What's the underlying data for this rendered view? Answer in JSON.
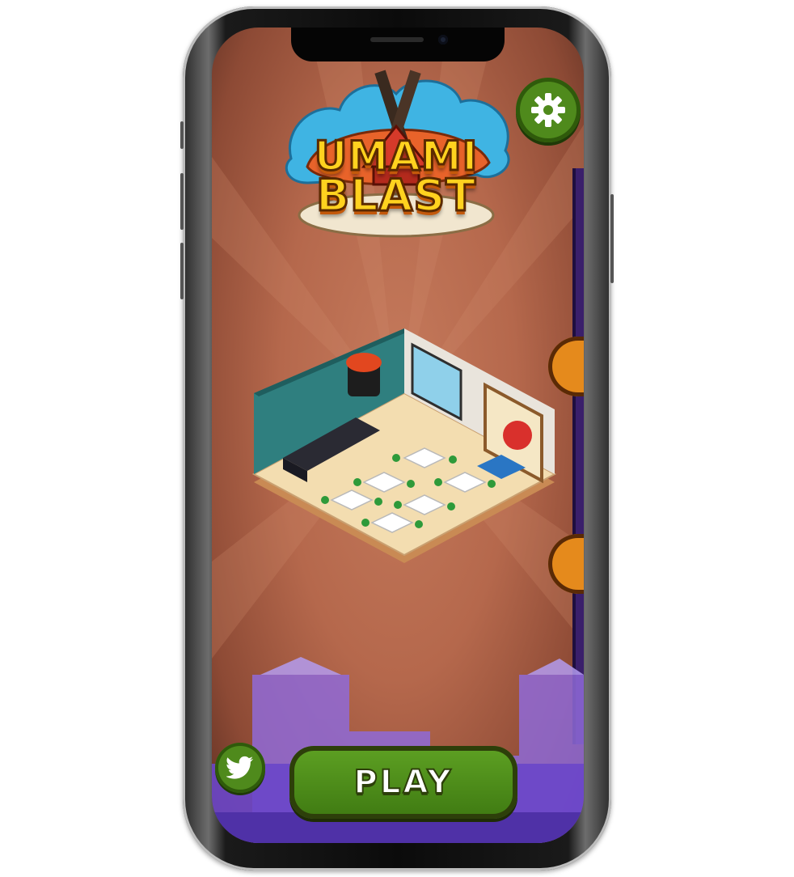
{
  "app": {
    "name": "Umami Blast"
  },
  "logo": {
    "line1": "UMAMI",
    "line2": "BLAST"
  },
  "settings": {
    "icon": "gear-icon"
  },
  "social": {
    "icon": "twitter-icon"
  },
  "play": {
    "label": "PLAY"
  },
  "colors": {
    "background": "#b5684c",
    "button_green": "#4f8a1c",
    "logo_yellow": "#ffd21f",
    "city_purple": "#8f6ad8"
  }
}
